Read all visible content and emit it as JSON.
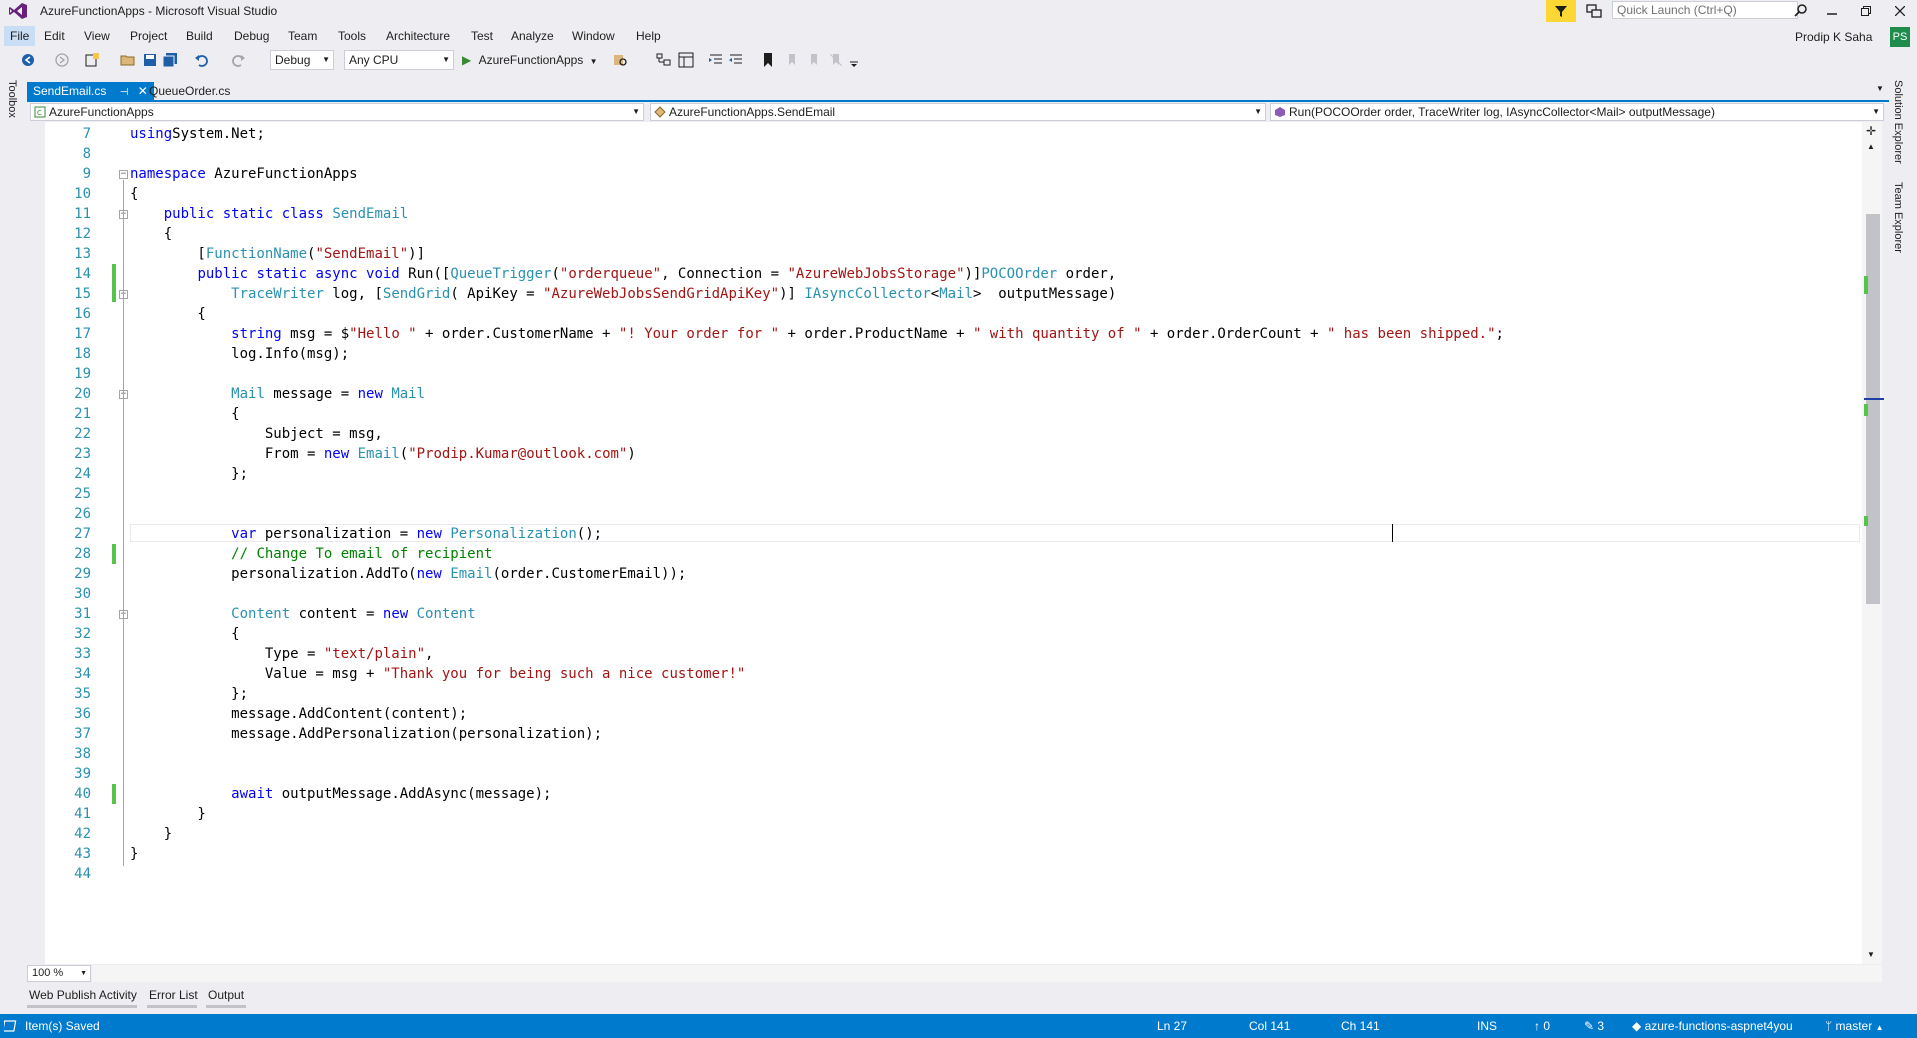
{
  "window": {
    "title": "AzureFunctionApps - Microsoft Visual Studio",
    "quick_launch_placeholder": "Quick Launch (Ctrl+Q)",
    "user_name": "Prodip K Saha",
    "user_initials": "PS"
  },
  "menu": [
    "File",
    "Edit",
    "View",
    "Project",
    "Build",
    "Debug",
    "Team",
    "Tools",
    "Architecture",
    "Test",
    "Analyze",
    "Window",
    "Help"
  ],
  "toolbar": {
    "configuration": "Debug",
    "platform": "Any CPU",
    "start_target": "AzureFunctionApps"
  },
  "left_strip": {
    "toolbox": "Toolbox"
  },
  "tabs": [
    {
      "label": "SendEmail.cs",
      "active": true
    },
    {
      "label": "QueueOrder.cs",
      "active": false
    }
  ],
  "navbar": {
    "project": "AzureFunctionApps",
    "type": "AzureFunctionApps.SendEmail",
    "member": "Run(POCOOrder order, TraceWriter log, IAsyncCollector<Mail> outputMessage)"
  },
  "side_tabs": [
    "Solution Explorer",
    "Team Explorer"
  ],
  "code": {
    "line_numbers": [
      "7",
      "8",
      "9",
      "10",
      "11",
      "12",
      "13",
      "14",
      "15",
      "16",
      "17",
      "18",
      "19",
      "20",
      "21",
      "22",
      "23",
      "24",
      "25",
      "26",
      "27",
      "28",
      "29",
      "30",
      "31",
      "32",
      "33",
      "34",
      "35",
      "36",
      "37",
      "38",
      "39",
      "40",
      "41",
      "42",
      "43",
      "44"
    ],
    "lines": [
      [
        [
          "kw",
          "using"
        ],
        [
          "",
          "System.Net;"
        ]
      ],
      [],
      [
        [
          "kw",
          "namespace"
        ],
        [
          "",
          " AzureFunctionApps"
        ]
      ],
      [
        [
          "",
          "{"
        ]
      ],
      [
        [
          "",
          "    "
        ],
        [
          "kw",
          "public static class"
        ],
        [
          "",
          " "
        ],
        [
          "ty",
          "SendEmail"
        ]
      ],
      [
        [
          "",
          "    {"
        ]
      ],
      [
        [
          "",
          "        ["
        ],
        [
          "ty",
          "FunctionName"
        ],
        [
          "",
          "("
        ],
        [
          "st",
          "\"SendEmail\""
        ],
        [
          "",
          ")]"
        ]
      ],
      [
        [
          "",
          "        "
        ],
        [
          "kw",
          "public static async void"
        ],
        [
          "",
          " Run(["
        ],
        [
          "ty",
          "QueueTrigger"
        ],
        [
          "",
          "("
        ],
        [
          "st",
          "\"orderqueue\""
        ],
        [
          "",
          ", Connection = "
        ],
        [
          "st",
          "\"AzureWebJobsStorage\""
        ],
        [
          "",
          ")]"
        ],
        [
          "ty",
          "POCOOrder"
        ],
        [
          "",
          " order,"
        ]
      ],
      [
        [
          "",
          "            "
        ],
        [
          "ty",
          "TraceWriter"
        ],
        [
          "",
          " log, ["
        ],
        [
          "ty",
          "SendGrid"
        ],
        [
          "",
          "( ApiKey = "
        ],
        [
          "st",
          "\"AzureWebJobsSendGridApiKey\""
        ],
        [
          "",
          ")] "
        ],
        [
          "ty",
          "IAsyncCollector"
        ],
        [
          "",
          "<"
        ],
        [
          "ty",
          "Mail"
        ],
        [
          "",
          ">  outputMessage)"
        ]
      ],
      [
        [
          "",
          "        {"
        ]
      ],
      [
        [
          "",
          "            "
        ],
        [
          "kw",
          "string"
        ],
        [
          "",
          " msg = $"
        ],
        [
          "st",
          "\"Hello \""
        ],
        [
          "",
          " + order.CustomerName + "
        ],
        [
          "st",
          "\"! Your order for \""
        ],
        [
          "",
          " + order.ProductName + "
        ],
        [
          "st",
          "\" with quantity of \""
        ],
        [
          "",
          " + order.OrderCount + "
        ],
        [
          "st",
          "\" has been shipped.\""
        ],
        [
          "",
          ";"
        ]
      ],
      [
        [
          "",
          "            log.Info(msg);"
        ]
      ],
      [],
      [
        [
          "",
          "            "
        ],
        [
          "ty",
          "Mail"
        ],
        [
          "",
          " message = "
        ],
        [
          "kw",
          "new"
        ],
        [
          "",
          " "
        ],
        [
          "ty",
          "Mail"
        ]
      ],
      [
        [
          "",
          "            {"
        ]
      ],
      [
        [
          "",
          "                Subject = msg,"
        ]
      ],
      [
        [
          "",
          "                From = "
        ],
        [
          "kw",
          "new"
        ],
        [
          "",
          " "
        ],
        [
          "ty",
          "Email"
        ],
        [
          "",
          "("
        ],
        [
          "st",
          "\"Prodip.Kumar@outlook.com\""
        ],
        [
          "",
          ")"
        ]
      ],
      [
        [
          "",
          "            };"
        ]
      ],
      [],
      [],
      [
        [
          "",
          "            "
        ],
        [
          "kw",
          "var"
        ],
        [
          "",
          " personalization = "
        ],
        [
          "kw",
          "new"
        ],
        [
          "",
          " "
        ],
        [
          "ty",
          "Personalization"
        ],
        [
          "",
          "();"
        ]
      ],
      [
        [
          "",
          "            "
        ],
        [
          "cm",
          "// Change To email of recipient"
        ]
      ],
      [
        [
          "",
          "            personalization.AddTo("
        ],
        [
          "kw",
          "new"
        ],
        [
          "",
          " "
        ],
        [
          "ty",
          "Email"
        ],
        [
          "",
          "(order.CustomerEmail));"
        ]
      ],
      [],
      [
        [
          "",
          "            "
        ],
        [
          "ty",
          "Content"
        ],
        [
          "",
          " content = "
        ],
        [
          "kw",
          "new"
        ],
        [
          "",
          " "
        ],
        [
          "ty",
          "Content"
        ]
      ],
      [
        [
          "",
          "            {"
        ]
      ],
      [
        [
          "",
          "                Type = "
        ],
        [
          "st",
          "\"text/plain\""
        ],
        [
          "",
          ","
        ]
      ],
      [
        [
          "",
          "                Value = msg + "
        ],
        [
          "st",
          "\"Thank you for being such a nice customer!\""
        ]
      ],
      [
        [
          "",
          "            };"
        ]
      ],
      [
        [
          "",
          "            message.AddContent(content);"
        ]
      ],
      [
        [
          "",
          "            message.AddPersonalization(personalization);"
        ]
      ],
      [],
      [],
      [
        [
          "",
          "            "
        ],
        [
          "kw",
          "await"
        ],
        [
          "",
          " outputMessage.AddAsync(message);"
        ]
      ],
      [
        [
          "",
          "        }"
        ]
      ],
      [
        [
          "",
          "    }"
        ]
      ],
      [
        [
          "",
          "}"
        ]
      ],
      []
    ]
  },
  "zoom": "100 %",
  "bottom_tabs": [
    "Web Publish Activity",
    "Error List",
    "Output"
  ],
  "status": {
    "message": "Item(s) Saved",
    "line": "Ln 27",
    "col": "Col 141",
    "ch": "Ch 141",
    "mode": "INS",
    "up_count": "0",
    "edit_count": "3",
    "repo": "azure-functions-aspnet4you",
    "branch": "master"
  },
  "colors": {
    "accent": "#007acc",
    "keyword": "#0000ff",
    "type": "#2b91af",
    "string": "#a31515",
    "comment": "#008000",
    "change_marker": "#57c34b"
  }
}
